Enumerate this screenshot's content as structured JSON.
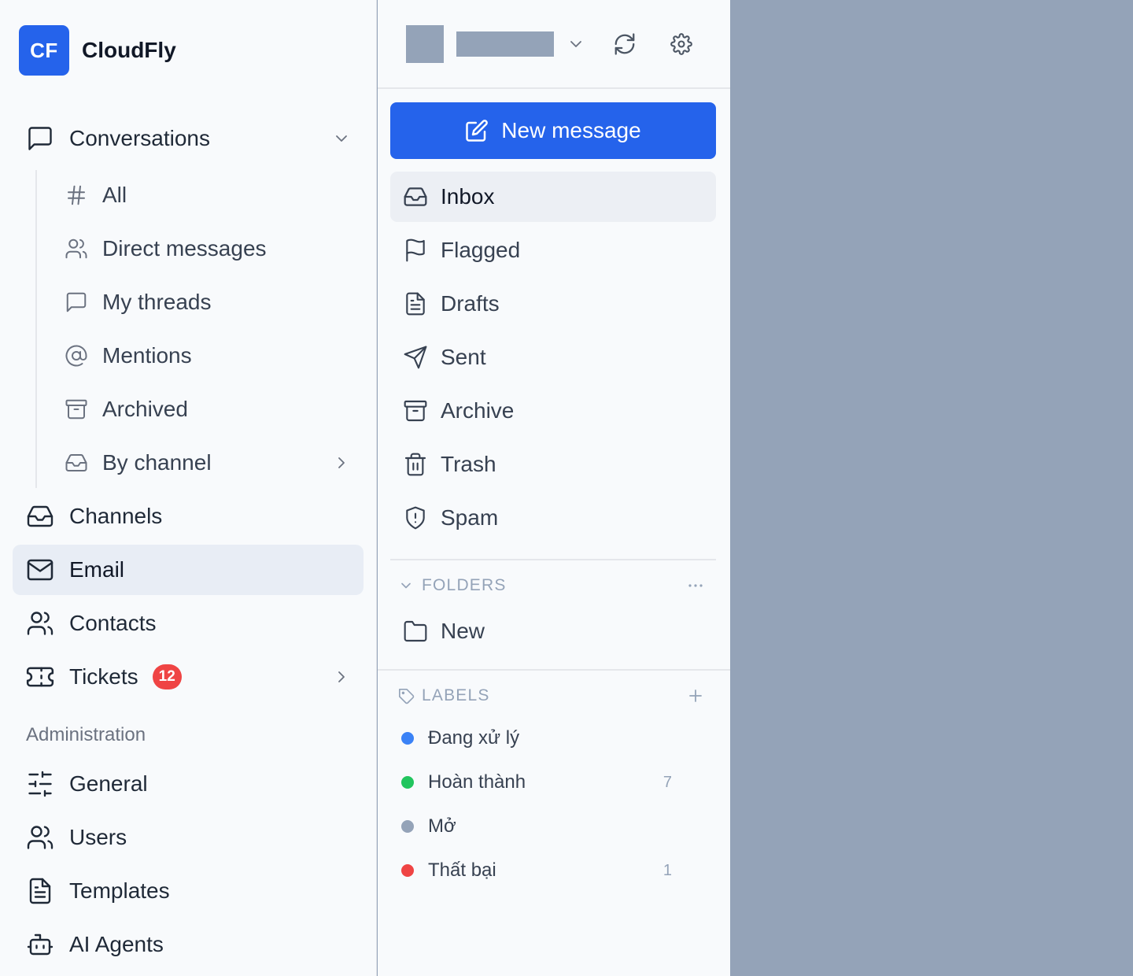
{
  "brand": {
    "logo_text": "CF",
    "name": "CloudFly",
    "color": "#2563eb"
  },
  "sidebar": {
    "conversations": {
      "label": "Conversations",
      "icon": "message-square-icon",
      "expanded": true,
      "sub_items": [
        {
          "label": "All",
          "icon": "hash-icon"
        },
        {
          "label": "Direct messages",
          "icon": "users-icon"
        },
        {
          "label": "My threads",
          "icon": "message-square-icon"
        },
        {
          "label": "Mentions",
          "icon": "at-sign-icon"
        },
        {
          "label": "Archived",
          "icon": "archive-icon"
        },
        {
          "label": "By channel",
          "icon": "inbox-icon",
          "has_submenu": true
        }
      ]
    },
    "items": [
      {
        "label": "Channels",
        "icon": "inbox-icon"
      },
      {
        "label": "Email",
        "icon": "mail-icon",
        "active": true
      },
      {
        "label": "Contacts",
        "icon": "users-icon"
      },
      {
        "label": "Tickets",
        "icon": "ticket-icon",
        "badge": "12",
        "has_submenu": true
      }
    ],
    "admin_section": {
      "title": "Administration",
      "items": [
        {
          "label": "General",
          "icon": "sliders-icon"
        },
        {
          "label": "Users",
          "icon": "users-icon"
        },
        {
          "label": "Templates",
          "icon": "file-text-icon"
        },
        {
          "label": "AI Agents",
          "icon": "bot-icon"
        }
      ]
    }
  },
  "mail": {
    "header": {
      "refresh_icon": "refresh-icon",
      "settings_icon": "gear-icon"
    },
    "new_message_label": "New message",
    "folders": [
      {
        "label": "Inbox",
        "icon": "inbox-icon",
        "active": true
      },
      {
        "label": "Flagged",
        "icon": "flag-icon"
      },
      {
        "label": "Drafts",
        "icon": "file-text-icon"
      },
      {
        "label": "Sent",
        "icon": "send-icon"
      },
      {
        "label": "Archive",
        "icon": "archive-icon"
      },
      {
        "label": "Trash",
        "icon": "trash-icon"
      },
      {
        "label": "Spam",
        "icon": "shield-alert-icon"
      }
    ],
    "custom_folders": {
      "title": "FOLDERS",
      "items": [
        {
          "label": "New",
          "icon": "folder-icon"
        }
      ]
    },
    "labels": {
      "title": "LABELS",
      "items": [
        {
          "label": "Đang xử lý",
          "color": "#3b82f6",
          "count": ""
        },
        {
          "label": "Hoàn thành",
          "color": "#22c55e",
          "count": "7"
        },
        {
          "label": "Mở",
          "color": "#94a3b8",
          "count": ""
        },
        {
          "label": "Thất bại",
          "color": "#ef4444",
          "count": "1"
        }
      ]
    }
  },
  "colors": {
    "accent": "#2563eb",
    "danger": "#ef4444",
    "placeholder_gray": "#94a3b8"
  }
}
